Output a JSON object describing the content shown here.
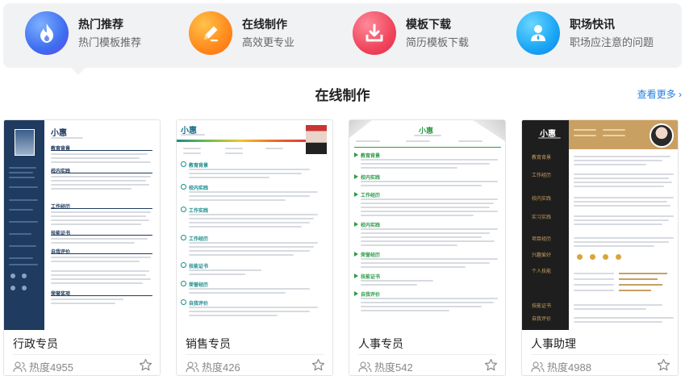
{
  "categories": [
    {
      "title": "热门推荐",
      "subtitle": "热门模板推荐",
      "icon": "fire-icon"
    },
    {
      "title": "在线制作",
      "subtitle": "高效更专业",
      "icon": "pencil-icon"
    },
    {
      "title": "模板下载",
      "subtitle": "简历模板下载",
      "icon": "download-icon"
    },
    {
      "title": "职场快讯",
      "subtitle": "职场应注意的问题",
      "icon": "person-icon"
    }
  ],
  "section": {
    "title": "在线制作",
    "more": "查看更多 ›"
  },
  "templates": [
    {
      "name": "行政专员",
      "heat": "热度4955",
      "resume": {
        "name": "小惠",
        "sections": [
          "教育背景",
          "校内实践",
          "工作经历",
          "技能证书",
          "自我评价",
          "荣誉奖项"
        ]
      }
    },
    {
      "name": "销售专员",
      "heat": "热度426",
      "resume": {
        "name": "小惠",
        "sections": [
          "教育背景",
          "校内实践",
          "工作实践",
          "工作经历",
          "技能证书",
          "荣誉经历",
          "自我评价"
        ]
      }
    },
    {
      "name": "人事专员",
      "heat": "热度542",
      "resume": {
        "name": "小惠",
        "sections": [
          "教育背景",
          "校内实践",
          "工作经历",
          "校内实践",
          "荣誉经历",
          "技能证书",
          "自我评价"
        ]
      }
    },
    {
      "name": "人事助理",
      "heat": "热度4988",
      "resume": {
        "name": "小惠",
        "sections": [
          "教育背景",
          "工作经历",
          "校内实践",
          "实习实践",
          "项目经历",
          "兴趣爱好",
          "个人技能",
          "技能证书",
          "自我评价"
        ]
      }
    }
  ],
  "colors": {
    "fire": "#3d7df5",
    "pencil": "#ff8a1d",
    "download": "#f0465c",
    "person": "#1aa6f5",
    "link": "#1e7fe0",
    "navy": "#1f3b60",
    "teal": "#1a8c8c",
    "green": "#2e9a48",
    "gold": "#c9a062"
  }
}
